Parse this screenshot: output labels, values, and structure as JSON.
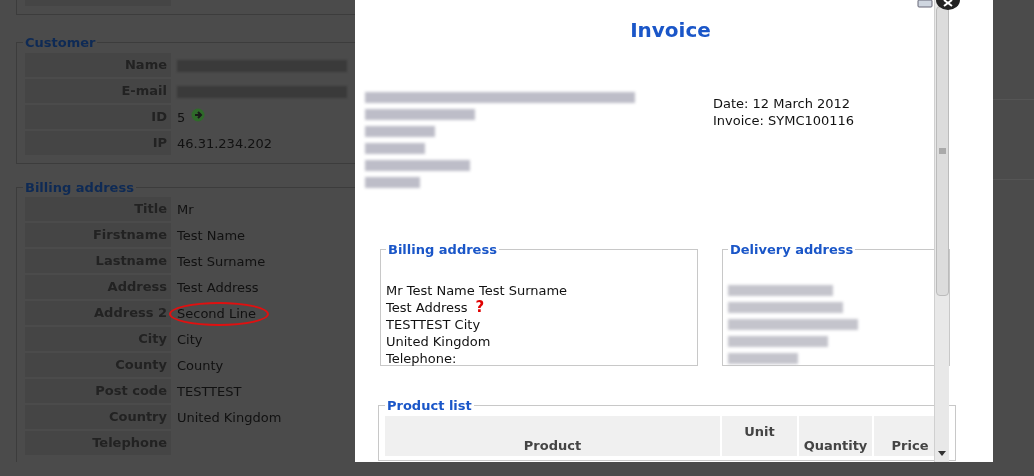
{
  "customer": {
    "legend": "Customer",
    "rows": [
      {
        "label": "Name",
        "kind": "redacted"
      },
      {
        "label": "E-mail",
        "kind": "redacted"
      },
      {
        "label": "ID",
        "value": "5",
        "kind": "link"
      },
      {
        "label": "IP",
        "value": "46.31.234.202",
        "kind": "text"
      }
    ]
  },
  "billing": {
    "legend": "Billing address",
    "rows": [
      {
        "label": "Title",
        "value": "Mr",
        "highlighted": false
      },
      {
        "label": "Firstname",
        "value": "Test Name",
        "highlighted": false
      },
      {
        "label": "Lastname",
        "value": "Test Surname",
        "highlighted": false
      },
      {
        "label": "Address",
        "value": "Test Address",
        "highlighted": false
      },
      {
        "label": "Address 2",
        "value": "Second Line",
        "highlighted": true
      },
      {
        "label": "City",
        "value": "City",
        "highlighted": false
      },
      {
        "label": "County",
        "value": "County",
        "highlighted": false
      },
      {
        "label": "Post code",
        "value": "TESTTEST",
        "highlighted": false
      },
      {
        "label": "Country",
        "value": "United Kingdom",
        "highlighted": false
      },
      {
        "label": "Telephone",
        "highlighted": false
      }
    ]
  },
  "invoice": {
    "title": "Invoice",
    "meta": [
      "Date: 12 March 2012",
      "Invoice: SYMC100116"
    ],
    "billing_address": {
      "legend": "Billing address",
      "flag_icon": "?",
      "lines": [
        {
          "text": "Mr Test Name Test Surname",
          "flagged": false
        },
        {
          "text": "Test Address",
          "flagged": true
        },
        {
          "text": "TESTTEST City",
          "flagged": false
        },
        {
          "text": "United Kingdom",
          "flagged": false
        },
        {
          "text": "Telephone:",
          "flagged": false
        }
      ]
    },
    "delivery_address": {
      "legend": "Delivery address"
    },
    "product_list": {
      "legend": "Product list",
      "columns": [
        "Product",
        "Unit",
        "Quantity",
        "Price"
      ]
    }
  }
}
